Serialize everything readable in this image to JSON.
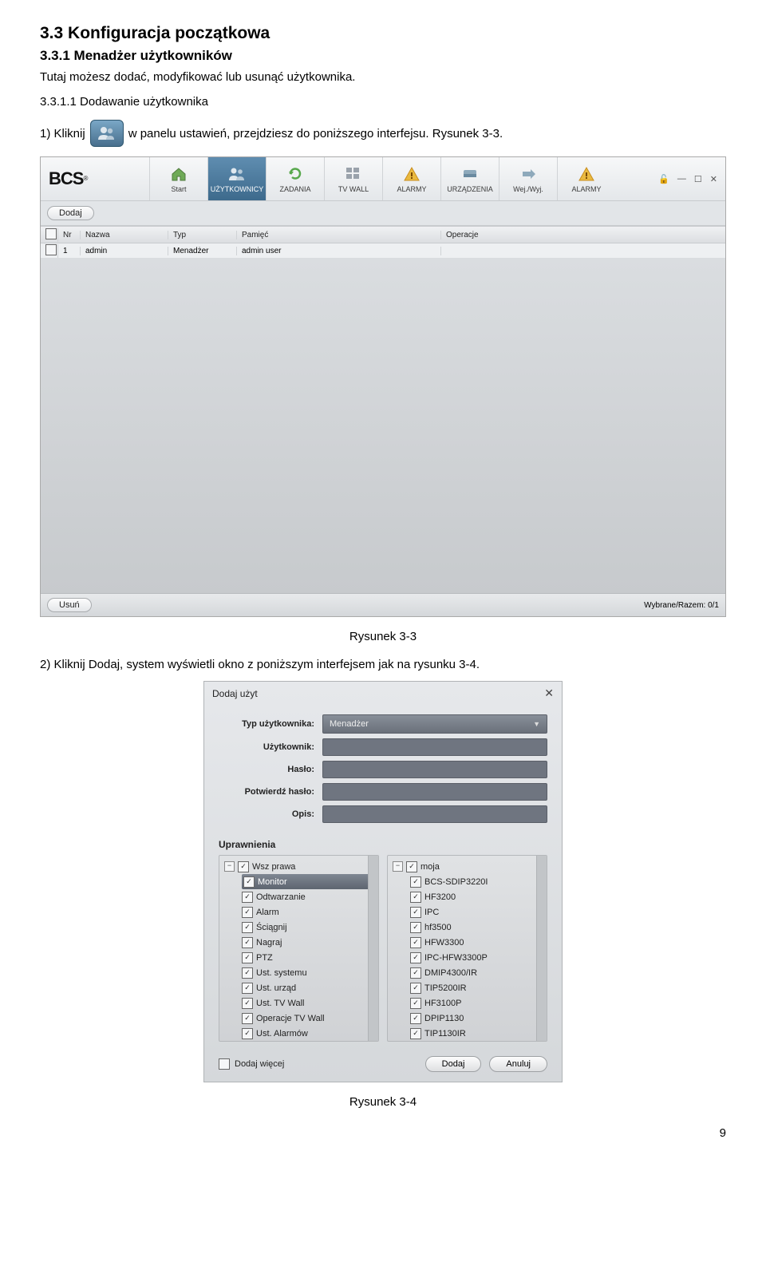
{
  "heading2": "3.3  Konfiguracja początkowa",
  "heading3": "3.3.1  Menadżer użytkowników",
  "intro_text": "Tutaj możesz dodać, modyfikować lub usunąć użytkownika.",
  "sub_heading": "3.3.1.1  Dodawanie użytkownika",
  "step1_before": "1)   Kliknij",
  "step1_after": " w panelu ustawień, przejdziesz do poniższego interfejsu. Rysunek 3-3.",
  "figure1_caption": "Rysunek 3-3",
  "step2_text": "2)   Kliknij Dodaj, system wyświetli okno z poniższym interfejsem jak na rysunku 3-4.",
  "figure2_caption": "Rysunek 3-4",
  "page_number": "9",
  "win1": {
    "logo": "BCS",
    "nav": [
      "Start",
      "UŻYTKOWNICY",
      "ZADANIA",
      "TV WALL",
      "ALARMY",
      "URZĄDZENIA",
      "Wej./Wyj.",
      "ALARMY"
    ],
    "wctrl": [
      "🔓",
      "—",
      "☐",
      "✕"
    ],
    "toolbar_add": "Dodaj",
    "list_headers": [
      "",
      "Nr",
      "Nazwa",
      "Typ",
      "Pamięć",
      "Operacje"
    ],
    "row": {
      "nr": "1",
      "name": "admin",
      "type": "Menadżer",
      "mem": "admin user",
      "op": ""
    },
    "footer_del": "Usuń",
    "footer_count": "Wybrane/Razem: 0/1"
  },
  "dlg": {
    "title": "Dodaj użyt",
    "labels": {
      "type": "Typ użytkownika:",
      "user": "Użytkownik:",
      "pass": "Hasło:",
      "confirm": "Potwierdź hasło:",
      "desc": "Opis:"
    },
    "type_value": "Menadżer",
    "perm_title": "Uprawnienia",
    "left_tree_root": "Wsz prawa",
    "left_tree": [
      "Monitor",
      "Odtwarzanie",
      "Alarm",
      "Ściągnij",
      "Nagraj",
      "PTZ",
      "Ust. systemu",
      "Ust. urząd",
      "Ust. TV Wall",
      "Operacje TV Wall",
      "Ust. Alarmów"
    ],
    "right_tree_root": "moja",
    "right_tree": [
      "BCS-SDIP3220I",
      "HF3200",
      "IPC",
      "hf3500",
      "HFW3300",
      "IPC-HFW3300P",
      "DMIP4300/IR",
      "TIP5200IR",
      "HF3100P",
      "DPIP1130",
      "TIP1130IR"
    ],
    "more_label": "Dodaj więcej",
    "btn_add": "Dodaj",
    "btn_cancel": "Anuluj"
  }
}
